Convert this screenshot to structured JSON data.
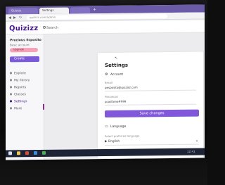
{
  "browser": {
    "tabs": [
      {
        "label": "Quizizz"
      },
      {
        "label": "Settings"
      },
      {
        "label": ""
      }
    ],
    "new_tab": "+",
    "url": "quizizz.com/admin"
  },
  "header": {
    "logo": "Quizizz",
    "search_label": "Search"
  },
  "sidebar": {
    "profile_name": "Precious Esposito",
    "profile_sub": "Basic account",
    "upgrade_label": "Upgrade",
    "create_label": "Create",
    "items": [
      {
        "label": "Explore"
      },
      {
        "label": "My library"
      },
      {
        "label": "Reports"
      },
      {
        "label": "Classes"
      },
      {
        "label": "Settings"
      },
      {
        "label": "More"
      }
    ]
  },
  "settings": {
    "title": "Settings",
    "account_section": "Account",
    "email_label": "Email",
    "email_value": "pesposito@quizizz.com",
    "password_label": "Password",
    "password_value": "pcosfame#999",
    "save_label": "Save changes",
    "language_section": "Language",
    "select_label": "Select preferred language",
    "select_value": "English",
    "select_flag": "▶",
    "select_arrow": "▾"
  },
  "taskbar": {
    "time": "12:41"
  },
  "colors": {
    "brand": "#46178f",
    "primary_button": "#8058d9",
    "upgrade": "#f6a1b6"
  }
}
